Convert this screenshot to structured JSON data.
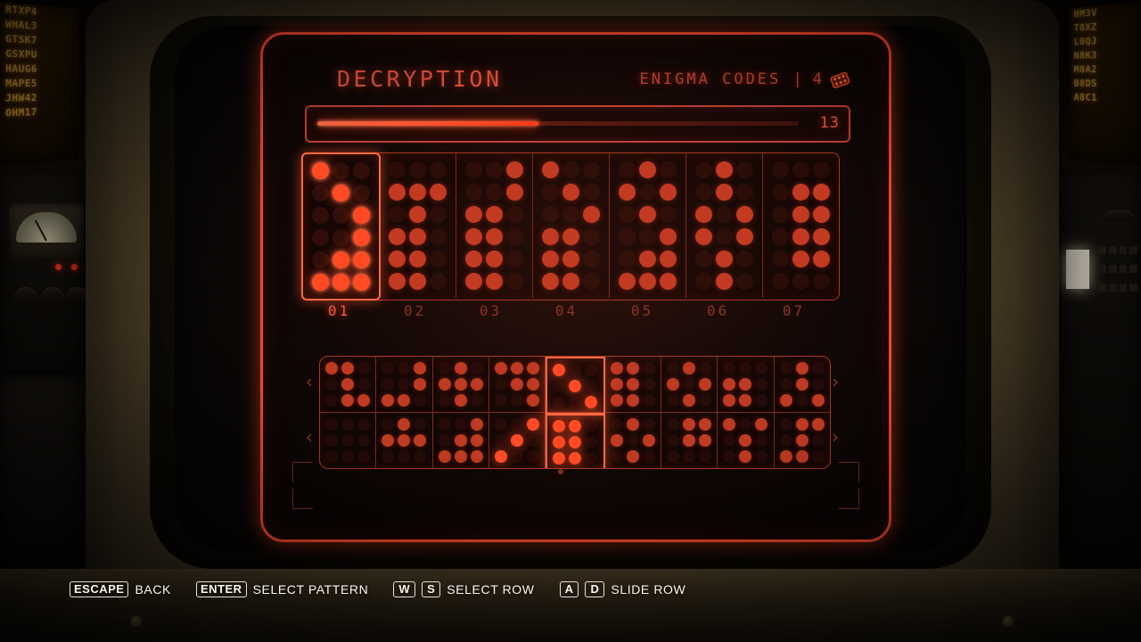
{
  "header": {
    "title": "DECRYPTION",
    "codes_label": "ENIGMA CODES |",
    "codes_count": "4",
    "card_icon": "enigma-card-icon"
  },
  "progress": {
    "value": "13",
    "percent": 46
  },
  "main_grid": {
    "cells": [
      {
        "label": "01",
        "selected": true,
        "rows": [
          [
            1,
            0,
            0
          ],
          [
            0,
            1,
            0
          ],
          [
            0,
            0,
            1
          ],
          [
            0,
            0,
            1
          ],
          [
            0,
            1,
            1
          ],
          [
            1,
            1,
            1
          ]
        ]
      },
      {
        "label": "02",
        "selected": false,
        "rows": [
          [
            0,
            0,
            0
          ],
          [
            1,
            1,
            1
          ],
          [
            0,
            1,
            0
          ],
          [
            1,
            1,
            0
          ],
          [
            1,
            1,
            0
          ],
          [
            1,
            1,
            0
          ]
        ]
      },
      {
        "label": "03",
        "selected": false,
        "rows": [
          [
            0,
            0,
            1
          ],
          [
            0,
            0,
            1
          ],
          [
            1,
            1,
            0
          ],
          [
            1,
            1,
            0
          ],
          [
            1,
            1,
            0
          ],
          [
            1,
            1,
            0
          ]
        ]
      },
      {
        "label": "04",
        "selected": false,
        "rows": [
          [
            1,
            0,
            0
          ],
          [
            0,
            1,
            0
          ],
          [
            0,
            0,
            1
          ],
          [
            1,
            1,
            0
          ],
          [
            1,
            1,
            0
          ],
          [
            1,
            1,
            0
          ]
        ]
      },
      {
        "label": "05",
        "selected": false,
        "rows": [
          [
            0,
            1,
            0
          ],
          [
            1,
            0,
            1
          ],
          [
            0,
            1,
            0
          ],
          [
            0,
            0,
            1
          ],
          [
            0,
            1,
            1
          ],
          [
            1,
            1,
            1
          ]
        ]
      },
      {
        "label": "06",
        "selected": false,
        "rows": [
          [
            0,
            1,
            0
          ],
          [
            0,
            1,
            0
          ],
          [
            1,
            0,
            1
          ],
          [
            1,
            0,
            1
          ],
          [
            0,
            1,
            0
          ],
          [
            0,
            1,
            0
          ]
        ]
      },
      {
        "label": "07",
        "selected": false,
        "rows": [
          [
            0,
            0,
            0
          ],
          [
            0,
            1,
            1
          ],
          [
            0,
            1,
            1
          ],
          [
            0,
            1,
            1
          ],
          [
            0,
            1,
            1
          ],
          [
            0,
            0,
            0
          ]
        ]
      }
    ]
  },
  "carousel": {
    "left_arrow": "‹",
    "right_arrow": "›",
    "rows": [
      {
        "name": "carousel-row-top",
        "cells": [
          {
            "selected": false,
            "highlight": false,
            "rows": [
              [
                1,
                1,
                0
              ],
              [
                0,
                1,
                0
              ],
              [
                0,
                1,
                1
              ]
            ]
          },
          {
            "selected": false,
            "highlight": false,
            "rows": [
              [
                0,
                0,
                1
              ],
              [
                0,
                0,
                1
              ],
              [
                1,
                1,
                0
              ]
            ]
          },
          {
            "selected": false,
            "highlight": false,
            "rows": [
              [
                0,
                1,
                0
              ],
              [
                1,
                1,
                1
              ],
              [
                0,
                1,
                0
              ]
            ]
          },
          {
            "selected": false,
            "highlight": false,
            "rows": [
              [
                1,
                1,
                1
              ],
              [
                0,
                1,
                1
              ],
              [
                0,
                0,
                1
              ]
            ]
          },
          {
            "selected": true,
            "highlight": true,
            "rows": [
              [
                1,
                0,
                0
              ],
              [
                0,
                1,
                0
              ],
              [
                0,
                0,
                1
              ]
            ]
          },
          {
            "selected": false,
            "highlight": false,
            "rows": [
              [
                1,
                1,
                0
              ],
              [
                1,
                1,
                0
              ],
              [
                1,
                1,
                0
              ]
            ]
          },
          {
            "selected": false,
            "highlight": false,
            "rows": [
              [
                0,
                1,
                0
              ],
              [
                1,
                0,
                1
              ],
              [
                0,
                1,
                0
              ]
            ]
          },
          {
            "selected": false,
            "highlight": false,
            "rows": [
              [
                0,
                0,
                0
              ],
              [
                1,
                1,
                0
              ],
              [
                1,
                1,
                0
              ]
            ]
          },
          {
            "selected": false,
            "highlight": false,
            "rows": [
              [
                0,
                1,
                0
              ],
              [
                0,
                1,
                0
              ],
              [
                1,
                0,
                1
              ]
            ]
          }
        ]
      },
      {
        "name": "carousel-row-bottom",
        "cells": [
          {
            "selected": false,
            "highlight": false,
            "rows": [
              [
                0,
                0,
                0
              ],
              [
                0,
                0,
                0
              ],
              [
                0,
                0,
                0
              ]
            ]
          },
          {
            "selected": false,
            "highlight": false,
            "rows": [
              [
                0,
                1,
                0
              ],
              [
                1,
                1,
                1
              ],
              [
                0,
                0,
                0
              ]
            ]
          },
          {
            "selected": false,
            "highlight": false,
            "rows": [
              [
                0,
                0,
                1
              ],
              [
                0,
                1,
                1
              ],
              [
                1,
                1,
                1
              ]
            ]
          },
          {
            "selected": false,
            "highlight": true,
            "rows": [
              [
                0,
                0,
                1
              ],
              [
                0,
                1,
                0
              ],
              [
                1,
                0,
                0
              ]
            ]
          },
          {
            "selected": true,
            "highlight": true,
            "rows": [
              [
                1,
                1,
                0
              ],
              [
                1,
                1,
                0
              ],
              [
                1,
                1,
                0
              ]
            ]
          },
          {
            "selected": false,
            "highlight": false,
            "rows": [
              [
                0,
                1,
                0
              ],
              [
                1,
                0,
                1
              ],
              [
                0,
                1,
                0
              ]
            ]
          },
          {
            "selected": false,
            "highlight": false,
            "rows": [
              [
                0,
                1,
                1
              ],
              [
                0,
                1,
                1
              ],
              [
                0,
                0,
                0
              ]
            ]
          },
          {
            "selected": false,
            "highlight": false,
            "rows": [
              [
                1,
                0,
                1
              ],
              [
                0,
                1,
                0
              ],
              [
                0,
                1,
                0
              ]
            ]
          },
          {
            "selected": false,
            "highlight": false,
            "rows": [
              [
                0,
                1,
                1
              ],
              [
                0,
                1,
                0
              ],
              [
                1,
                1,
                0
              ]
            ]
          }
        ]
      }
    ]
  },
  "hints": [
    {
      "keys": [
        "ESCAPE"
      ],
      "label": "BACK"
    },
    {
      "keys": [
        "ENTER"
      ],
      "label": "SELECT PATTERN"
    },
    {
      "keys": [
        "W",
        "S"
      ],
      "label": "SELECT ROW"
    },
    {
      "keys": [
        "A",
        "D"
      ],
      "label": "SLIDE ROW"
    }
  ],
  "background": {
    "left_monitor_lines": [
      "RTXP4",
      "WHAL3",
      "GTSK7",
      "GSXPU",
      "HAUG6",
      "MAPE5",
      "JHW42",
      "OHM17"
    ],
    "right_monitor_lines": [
      "HM3V",
      "T8XZ",
      "L8QJ",
      "N8K3",
      "M8A2",
      "B8DS",
      "A8C1"
    ]
  },
  "colors": {
    "accent": "#ff4a23",
    "accent_dim": "#c33a22",
    "frame": "#f0472b",
    "text": "#e8553a",
    "amber": "#ffc34a"
  }
}
